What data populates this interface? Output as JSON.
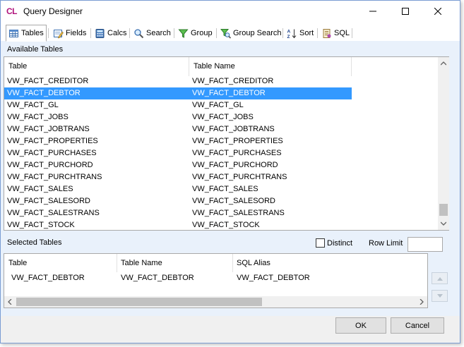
{
  "window": {
    "logo": "CL",
    "title": "Query Designer"
  },
  "tabs": [
    {
      "label": "Tables",
      "icon": "table-grid-icon"
    },
    {
      "label": "Fields",
      "icon": "fields-edit-icon"
    },
    {
      "label": "Calcs",
      "icon": "calculator-icon"
    },
    {
      "label": "Search",
      "icon": "magnifier-icon"
    },
    {
      "label": "Group",
      "icon": "funnel-icon"
    },
    {
      "label": "Group Search",
      "icon": "funnel-search-icon"
    },
    {
      "label": "Sort",
      "icon": "sort-az-icon"
    },
    {
      "label": "SQL",
      "icon": "sql-script-icon"
    }
  ],
  "available": {
    "section_label": "Available Tables",
    "columns": [
      "Table",
      "Table Name"
    ],
    "rows": [
      [
        "VW_FACT_CREDITOR",
        "VW_FACT_CREDITOR"
      ],
      [
        "VW_FACT_DEBTOR",
        "VW_FACT_DEBTOR"
      ],
      [
        "VW_FACT_GL",
        "VW_FACT_GL"
      ],
      [
        "VW_FACT_JOBS",
        "VW_FACT_JOBS"
      ],
      [
        "VW_FACT_JOBTRANS",
        "VW_FACT_JOBTRANS"
      ],
      [
        "VW_FACT_PROPERTIES",
        "VW_FACT_PROPERTIES"
      ],
      [
        "VW_FACT_PURCHASES",
        "VW_FACT_PURCHASES"
      ],
      [
        "VW_FACT_PURCHORD",
        "VW_FACT_PURCHORD"
      ],
      [
        "VW_FACT_PURCHTRANS",
        "VW_FACT_PURCHTRANS"
      ],
      [
        "VW_FACT_SALES",
        "VW_FACT_SALES"
      ],
      [
        "VW_FACT_SALESORD",
        "VW_FACT_SALESORD"
      ],
      [
        "VW_FACT_SALESTRANS",
        "VW_FACT_SALESTRANS"
      ],
      [
        "VW_FACT_STOCK",
        "VW_FACT_STOCK"
      ]
    ],
    "selected_row_index": 1
  },
  "selected": {
    "section_label": "Selected Tables",
    "distinct_label": "Distinct",
    "distinct_checked": false,
    "row_limit_label": "Row Limit",
    "row_limit_value": "",
    "columns": [
      "Table",
      "Table Name",
      "SQL Alias"
    ],
    "rows": [
      [
        "VW_FACT_DEBTOR",
        "VW_FACT_DEBTOR",
        "VW_FACT_DEBTOR"
      ]
    ]
  },
  "buttons": {
    "ok": "OK",
    "cancel": "Cancel"
  },
  "colors": {
    "selection": "#3399ff",
    "content_bg": "#e9f1fb",
    "logo": "#b0147c"
  }
}
